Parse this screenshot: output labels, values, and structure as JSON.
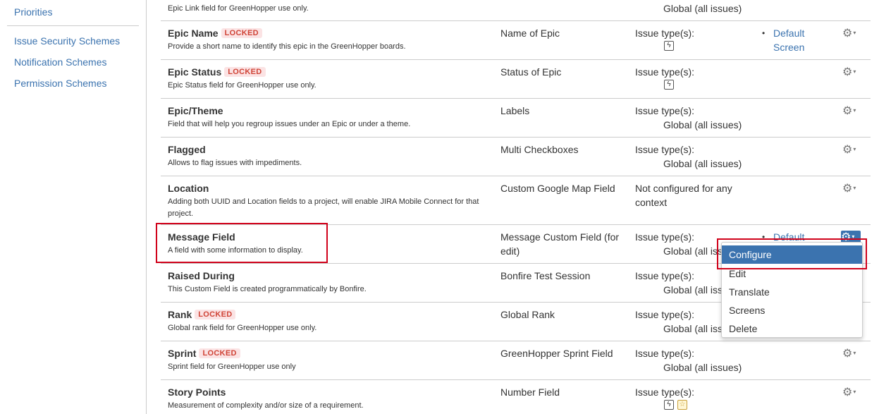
{
  "sidebar": {
    "items": [
      {
        "label": "Priorities"
      },
      {
        "label": "Issue Security Schemes"
      },
      {
        "label": "Notification Schemes"
      },
      {
        "label": "Permission Schemes"
      }
    ]
  },
  "top_partial": {
    "desc": "Epic Link field for GreenHopper use only.",
    "context": "Global (all issues)"
  },
  "rows": [
    {
      "name": "Epic Name",
      "locked": "LOCKED",
      "desc": "Provide a short name to identify this epic in the GreenHopper boards.",
      "type": "Name of Epic",
      "context_label": "Issue type(s):",
      "screen": "Default Screen"
    },
    {
      "name": "Epic Status",
      "locked": "LOCKED",
      "desc": "Epic Status field for GreenHopper use only.",
      "type": "Status of Epic",
      "context_label": "Issue type(s):"
    },
    {
      "name": "Epic/Theme",
      "desc": "Field that will help you regroup issues under an Epic or under a theme.",
      "type": "Labels",
      "context_label": "Issue type(s):",
      "context_value": "Global (all issues)"
    },
    {
      "name": "Flagged",
      "desc": "Allows to flag issues with impediments.",
      "type": "Multi Checkboxes",
      "context_label": "Issue type(s):",
      "context_value": "Global (all issues)"
    },
    {
      "name": "Location",
      "desc": "Adding both UUID and Location fields to a project, will enable JIRA Mobile Connect for that project.",
      "type": "Custom Google Map Field",
      "context_multi": "Not configured for any context"
    },
    {
      "name": "Message Field",
      "desc": "A field with some information to display.",
      "type": "Message Custom Field (for edit)",
      "context_label": "Issue type(s):",
      "context_value": "Global (all issue",
      "screen": "Default"
    },
    {
      "name": "Raised During",
      "desc": "This Custom Field is created programmatically by Bonfire.",
      "type": "Bonfire Test Session",
      "context_label": "Issue type(s):",
      "context_value": "Global (all iss"
    },
    {
      "name": "Rank",
      "locked": "LOCKED",
      "desc": "Global rank field for GreenHopper use only.",
      "type": "Global Rank",
      "context_label": "Issue type(s):",
      "context_value": "Global (all iss"
    },
    {
      "name": "Sprint",
      "locked": "LOCKED",
      "desc": "Sprint field for GreenHopper use only",
      "type": "GreenHopper Sprint Field",
      "context_label": "Issue type(s):",
      "context_value": "Global (all issues)"
    },
    {
      "name": "Story Points",
      "desc": "Measurement of complexity and/or size of a requirement.",
      "type": "Number Field",
      "context_label": "Issue type(s):"
    }
  ],
  "dropdown": {
    "items": [
      "Configure",
      "Edit",
      "Translate",
      "Screens",
      "Delete"
    ]
  },
  "icons": {
    "gear": "⚙",
    "caret": "▾",
    "epic": "ϟ",
    "bulb": "☆",
    "bullet": "•"
  },
  "colors": {
    "link": "#3b73af",
    "locked_bg": "#fbe3e4",
    "locked_fg": "#d04437",
    "highlight": "#d0021b"
  }
}
